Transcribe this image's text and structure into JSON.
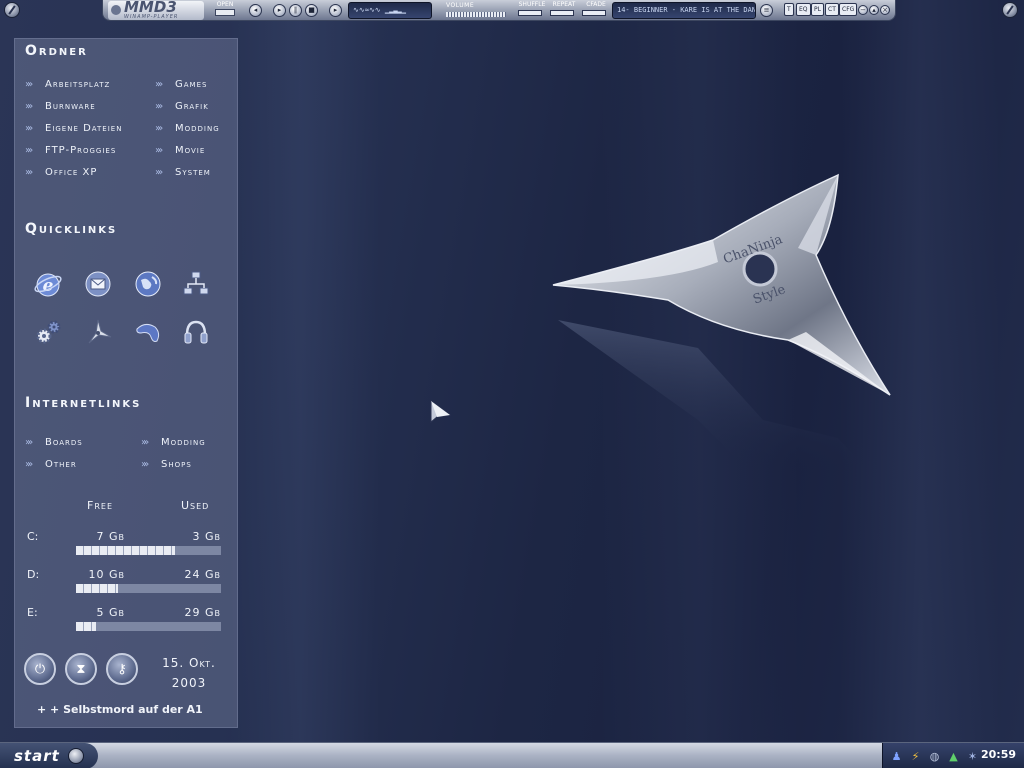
{
  "player": {
    "logo": "MMD",
    "logo_num": "3",
    "logo_sub": "WINAMP-PLAYER",
    "open_label": "OPEN",
    "volume_label": "VOLUME",
    "toggles": [
      "SHUFFLE",
      "REPEAT",
      "CFADE"
    ],
    "track": "14- BEGINNER - KARE IS AT THE DAN",
    "menu_buttons": [
      "T",
      "EQ",
      "PL",
      "CT",
      "CFG"
    ]
  },
  "panel": {
    "folders_title": "Ordner",
    "folders": [
      "Arbeitsplatz",
      "Burnware",
      "Eigene Dateien",
      "FTP-Proggies",
      "Office XP",
      "Games",
      "Grafik",
      "Modding",
      "Movie",
      "System"
    ],
    "quicklinks_title": "Quicklinks",
    "quicklinks": [
      "internet-explorer-icon",
      "outlook-icon",
      "globe-icon",
      "network-icon",
      "gears-icon",
      "shuriken-icon",
      "boomerang-icon",
      "headphones-icon"
    ],
    "internet_title": "Internetlinks",
    "internet_links": [
      "Boards",
      "Other",
      "Modding",
      "Shops"
    ],
    "disk": {
      "free_label": "Free",
      "used_label": "Used",
      "drives": [
        {
          "label": "C:",
          "free": "7 Gb",
          "used": "3 Gb",
          "free_fraction": 0.68
        },
        {
          "label": "D:",
          "free": "10 Gb",
          "used": "24 Gb",
          "free_fraction": 0.29
        },
        {
          "label": "E:",
          "free": "5 Gb",
          "used": "29 Gb",
          "free_fraction": 0.14
        }
      ]
    },
    "date_line1": "15. Okt.",
    "date_line2": "2003",
    "footer": "+ +  Selbstmord auf der A1"
  },
  "wallpaper": {
    "shuriken_text_1": "ChaNinja",
    "shuriken_text_2": "Style"
  },
  "taskbar": {
    "start_label": "start",
    "clock": "20:59"
  }
}
